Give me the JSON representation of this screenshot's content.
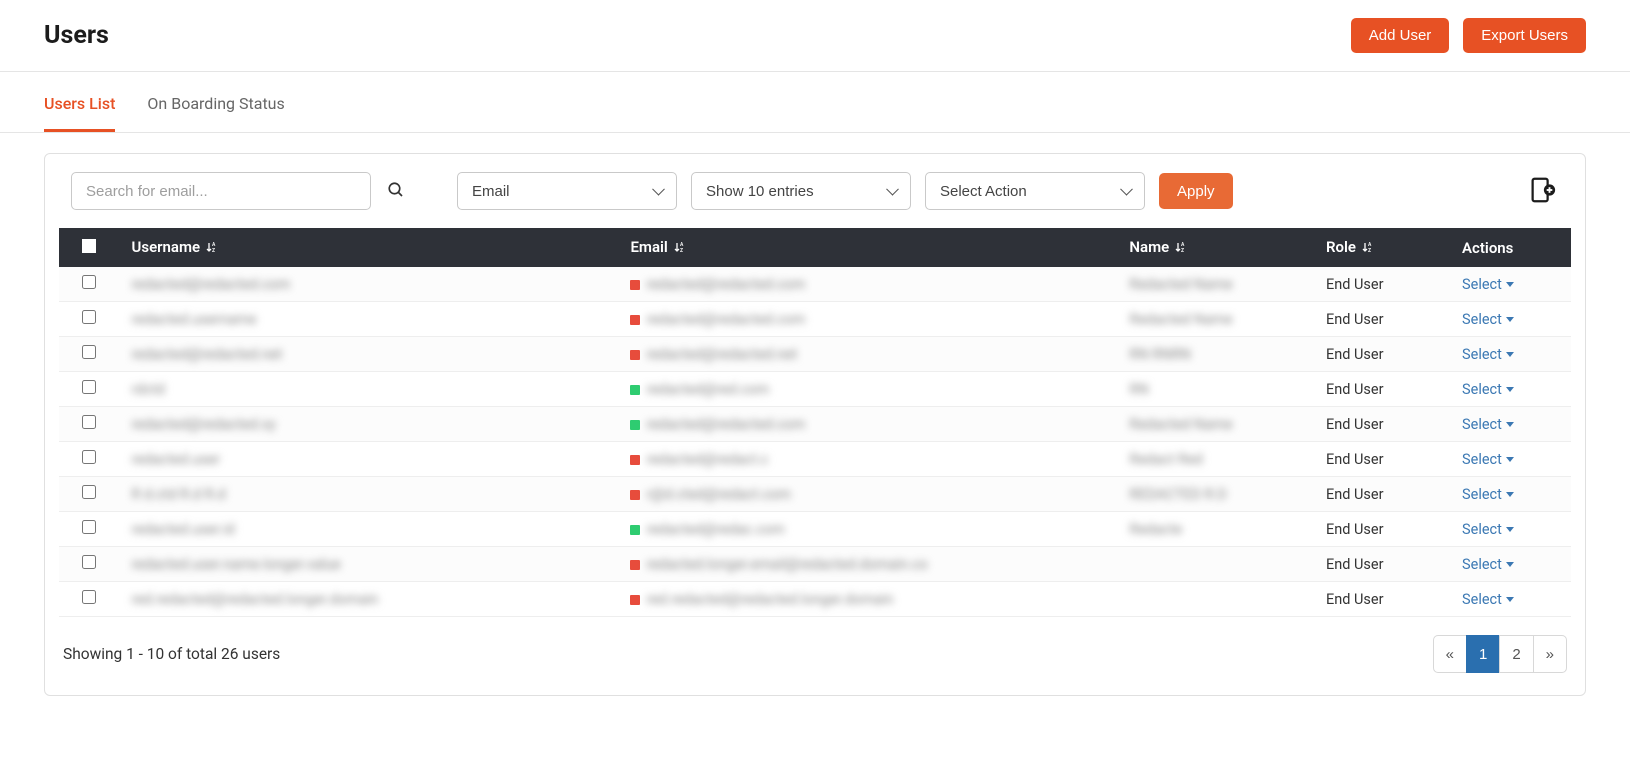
{
  "header": {
    "title": "Users",
    "add_user_label": "Add User",
    "export_users_label": "Export Users"
  },
  "tabs": {
    "users_list": "Users List",
    "onboarding_status": "On Boarding Status"
  },
  "toolbar": {
    "search_placeholder": "Search for email...",
    "email_filter": "Email",
    "entries": "Show 10 entries",
    "action": "Select Action",
    "apply_label": "Apply"
  },
  "table": {
    "headers": {
      "username": "Username",
      "email": "Email",
      "name": "Name",
      "role": "Role",
      "actions": "Actions"
    },
    "rows": [
      {
        "username": "redacted@redacted.com",
        "email": "redacted@redacted.com",
        "name": "Redacted Name",
        "role": "End User",
        "action": "Select",
        "dot": "red"
      },
      {
        "username": "redacted.username",
        "email": "redacted@redacted.com",
        "name": "Redacted Name",
        "role": "End User",
        "action": "Select",
        "dot": "red"
      },
      {
        "username": "redacted@redacted.net",
        "email": "redacted@redacted.net",
        "name": "RN RNRN",
        "role": "End User",
        "action": "Select",
        "dot": "red"
      },
      {
        "username": "rdctd",
        "email": "redacted@red.com",
        "name": "RN",
        "role": "End User",
        "action": "Select",
        "dot": "green"
      },
      {
        "username": "redacted@redacted.xy",
        "email": "redacted@redacted.com",
        "name": "Redacted Name",
        "role": "End User",
        "action": "Select",
        "dot": "green"
      },
      {
        "username": "redacted.user",
        "email": "redacted@redact.c",
        "name": "Redact Red",
        "role": "End User",
        "action": "Select",
        "dot": "red"
      },
      {
        "username": "R d.ctd R.d R.d",
        "email": "r@d.cted@redact.com",
        "name": "REDACTED R.D",
        "role": "End User",
        "action": "Select",
        "dot": "red"
      },
      {
        "username": "redacted.user.id",
        "email": "redacted@redac.com",
        "name": "Redacte",
        "role": "End User",
        "action": "Select",
        "dot": "green"
      },
      {
        "username": "redacted.user.name.longer.value",
        "email": "redacted.longer.email@redacted.domain.co",
        "name": "",
        "role": "End User",
        "action": "Select",
        "dot": "red"
      },
      {
        "username": "red.redacted@redacted.longer.domain",
        "email": "red.redacted@redacted.longer.domain",
        "name": "",
        "role": "End User",
        "action": "Select",
        "dot": "red"
      }
    ]
  },
  "footer": {
    "showing_text": "Showing 1 - 10 of total 26 users",
    "pages": {
      "prev": "«",
      "p1": "1",
      "p2": "2",
      "next": "»"
    }
  }
}
